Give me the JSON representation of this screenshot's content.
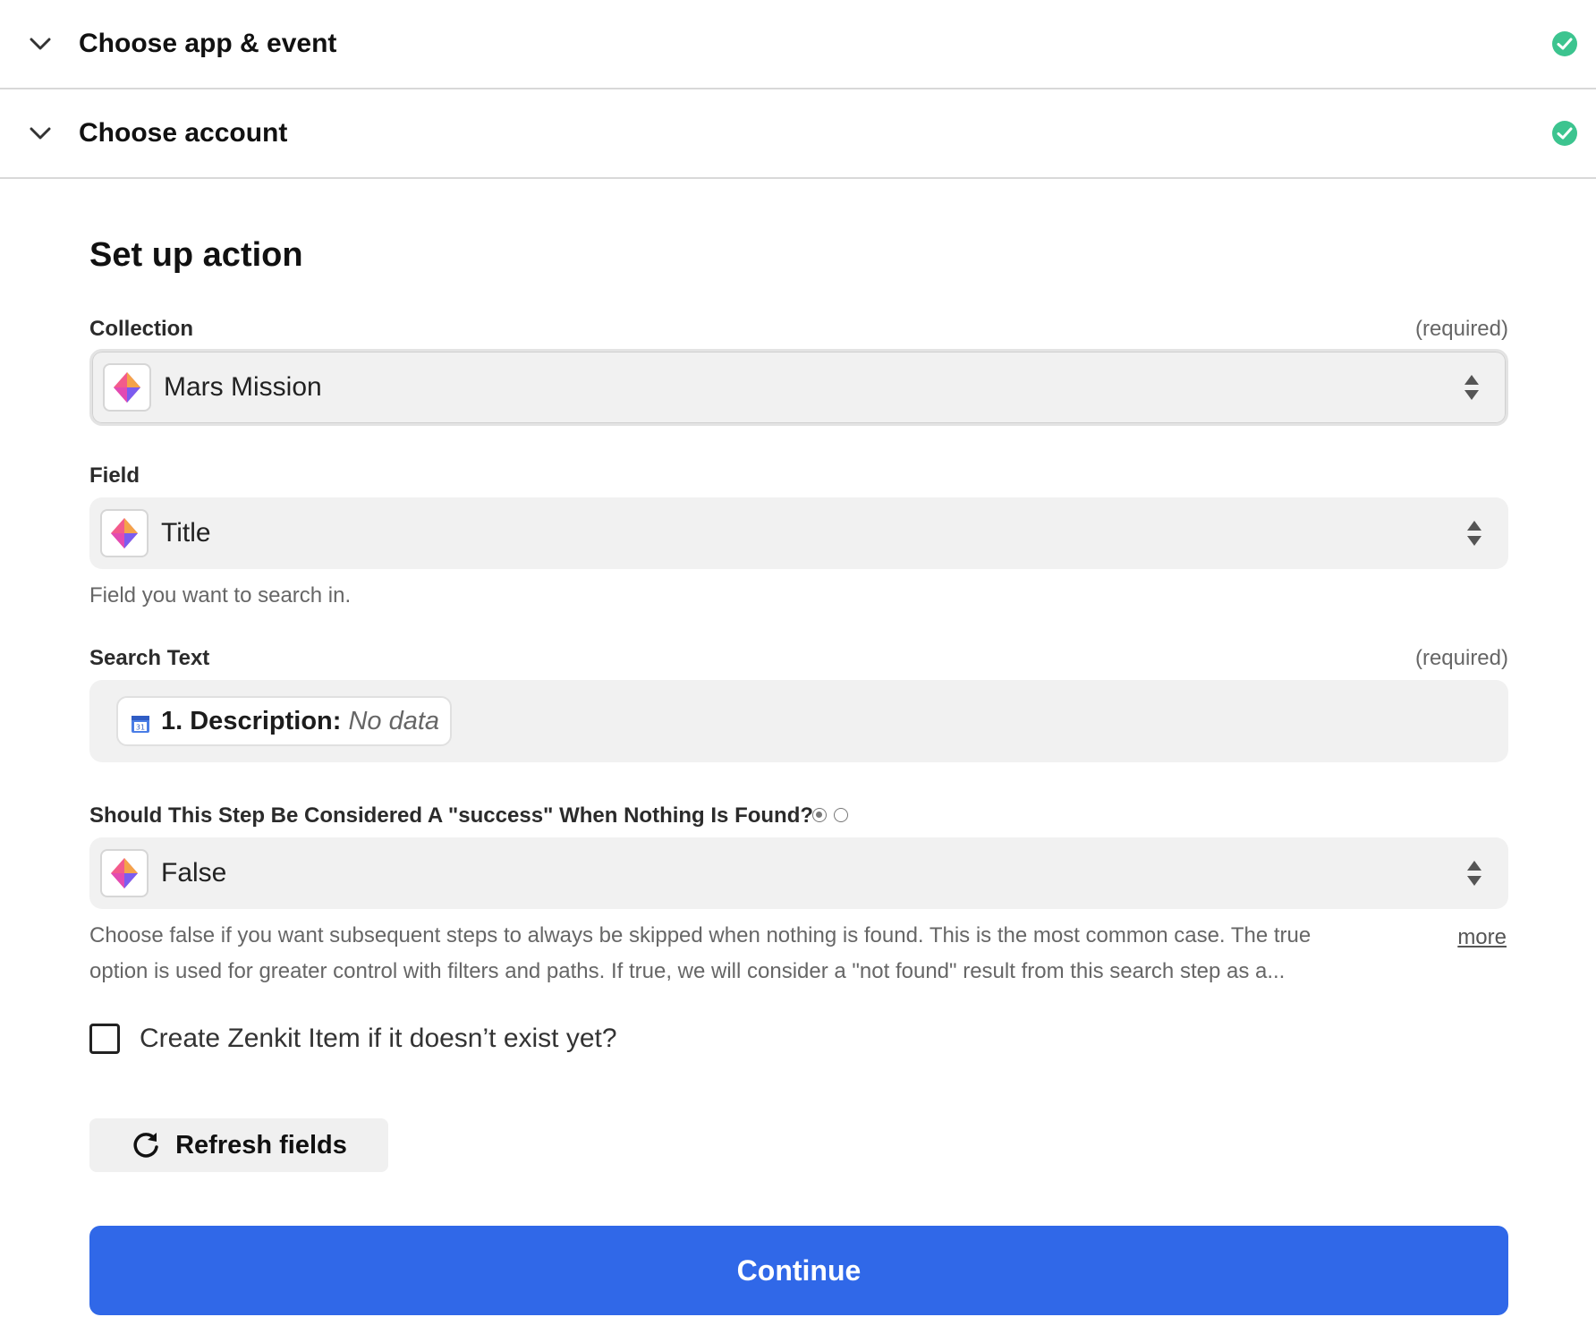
{
  "sections": [
    {
      "title": "Choose app & event",
      "status": "complete"
    },
    {
      "title": "Choose account",
      "status": "complete"
    }
  ],
  "main": {
    "title": "Set up action",
    "collection": {
      "label": "Collection",
      "required": "(required)",
      "value": "Mars Mission"
    },
    "field": {
      "label": "Field",
      "value": "Title",
      "help": "Field you want to search in."
    },
    "search_text": {
      "label": "Search Text",
      "required": "(required)",
      "pill_label": "1. Description:",
      "pill_value": "No data"
    },
    "success_when_not_found": {
      "label": "Should This Step Be Considered A \"success\" When Nothing Is Found?",
      "value": "False",
      "help_line1": "Choose false if you want subsequent steps to always be skipped when nothing is found. This is the most common case. The true",
      "help_line2": "option is used for greater control with filters and paths. If true, we will consider a \"not found\" result from this search step as a...",
      "more": "more"
    },
    "create_item": {
      "label": "Create Zenkit Item if it doesn’t exist yet?",
      "checked": false
    },
    "refresh_button": "Refresh fields",
    "continue_button": "Continue"
  },
  "colors": {
    "accent": "#3068e8",
    "success": "#3cc48f"
  }
}
